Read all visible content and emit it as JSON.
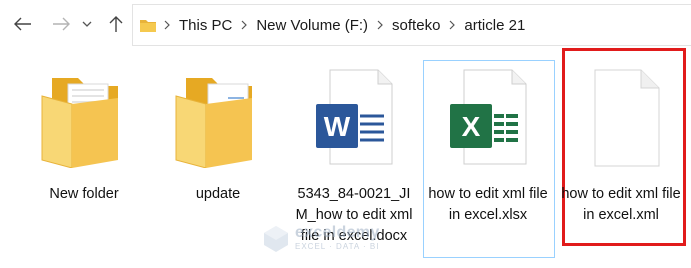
{
  "navigation": {
    "back_icon": "arrow-left-icon",
    "forward_icon": "arrow-right-icon",
    "recent_icon": "chevron-down-icon",
    "up_icon": "arrow-up-icon"
  },
  "breadcrumb": {
    "items": [
      "This PC",
      "New Volume (F:)",
      "softeko",
      "article 21"
    ]
  },
  "files": [
    {
      "name": "New folder",
      "type": "folder"
    },
    {
      "name": "update",
      "type": "folder"
    },
    {
      "name": "5343_84-0021_JIM_how to edit xml file in excel.docx",
      "type": "word-document"
    },
    {
      "name": "how to edit xml file in excel.xlsx",
      "type": "excel-workbook",
      "selected": true
    },
    {
      "name": "how to edit xml file in excel.xml",
      "type": "xml-file",
      "highlighted": true
    }
  ],
  "watermark": {
    "name": "exceldemy",
    "tagline": "EXCEL · DATA · BI"
  },
  "colors": {
    "folder": "#f5c451",
    "word_blue": "#2b579a",
    "excel_green": "#217346",
    "selection_border": "#99d1ff",
    "highlight_red": "#e11b1b"
  }
}
